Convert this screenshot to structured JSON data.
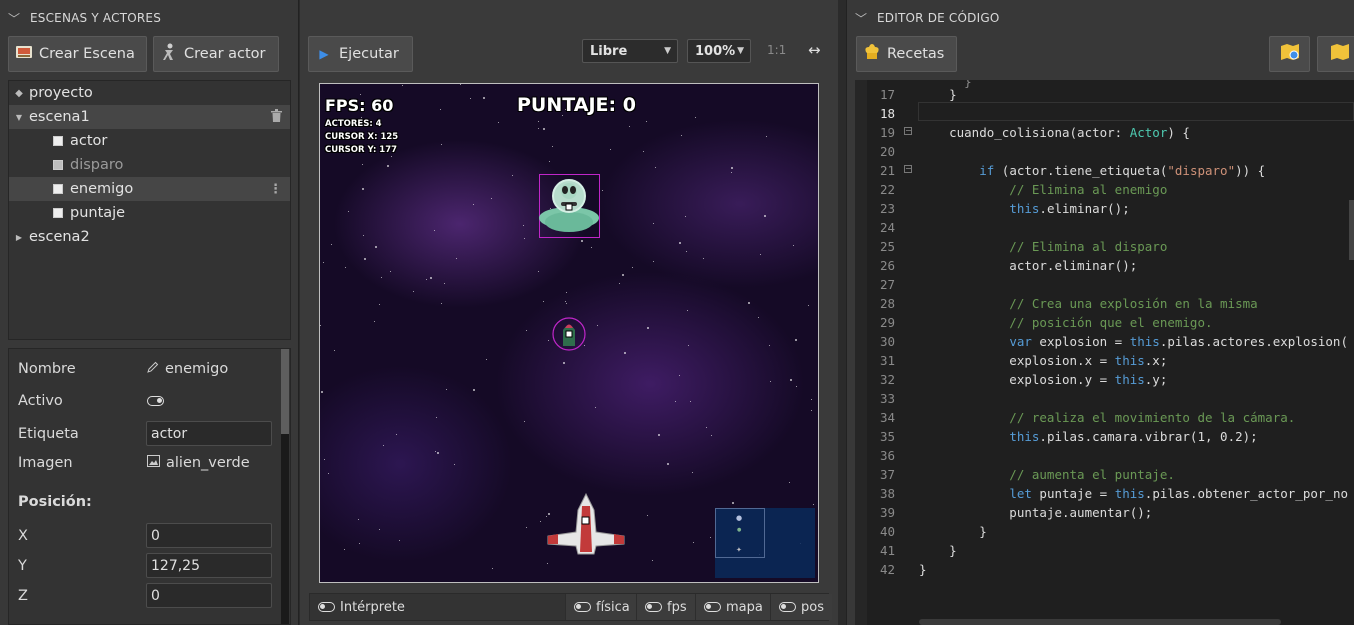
{
  "left_panel": {
    "header": "ESCENAS Y ACTORES",
    "create_scene_label": "Crear Escena",
    "create_actor_label": "Crear actor",
    "tree": {
      "project": "proyecto",
      "scene1": "escena1",
      "actors": [
        "actor",
        "disparo",
        "enemigo",
        "puntaje"
      ],
      "scene2": "escena2"
    },
    "properties": {
      "name_label": "Nombre",
      "name_value": "enemigo",
      "active_label": "Activo",
      "tag_label": "Etiqueta",
      "tag_value": "actor",
      "image_label": "Imagen",
      "image_value": "alien_verde",
      "position_heading": "Posición:",
      "x_label": "X",
      "x_value": "0",
      "y_label": "Y",
      "y_value": "127,25",
      "z_label": "Z",
      "z_value": "0"
    }
  },
  "center_panel": {
    "run_label": "Ejecutar",
    "mode_select": "Libre",
    "zoom_select": "100%",
    "ratio_label": "1:1",
    "expand_icon": "↔",
    "game": {
      "fps": "FPS: 60",
      "score": "PUNTAJE: 0",
      "actors_count": "ACTORES: 4",
      "cursor_x": "CURSOR X: 125",
      "cursor_y": "CURSOR Y: 177"
    },
    "bottom_bar": {
      "interpreter": "Intérprete",
      "physics": "física",
      "fps": "fps",
      "map": "mapa",
      "pos": "pos"
    }
  },
  "right_panel": {
    "header": "EDITOR DE CÓDIGO",
    "recipes_label": "Recetas",
    "current_line": 18,
    "line_numbers": [
      "17",
      "18",
      "19",
      "20",
      "21",
      "22",
      "23",
      "24",
      "25",
      "26",
      "27",
      "28",
      "29",
      "30",
      "31",
      "32",
      "33",
      "34",
      "35",
      "36",
      "37",
      "38",
      "39",
      "40",
      "41",
      "42"
    ]
  },
  "colors": {
    "accent_blue": "#3d8ee8",
    "selection_magenta": "#c026c9",
    "comment_green": "#6a9955",
    "keyword_blue": "#569cd6",
    "string_orange": "#ce9178"
  }
}
